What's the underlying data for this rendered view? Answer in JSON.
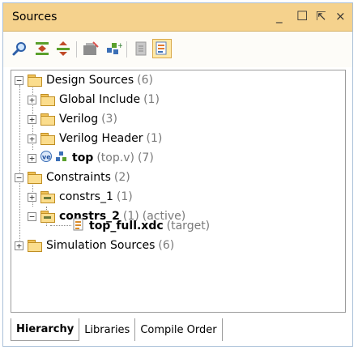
{
  "panel": {
    "title": "Sources",
    "controls": {
      "minimize": "_",
      "maximize": "☐",
      "restore": "⇱",
      "close": "×"
    }
  },
  "toolbar": {
    "buttons": [
      "search",
      "collapse-all",
      "expand-all",
      "add-sources",
      "open-hierarchy",
      "properties",
      "show-hierarchy-active"
    ]
  },
  "tree": {
    "design_sources": {
      "label": "Design Sources",
      "count": "(6)"
    },
    "global_include": {
      "label": "Global Include",
      "count": "(1)"
    },
    "verilog": {
      "label": "Verilog",
      "count": "(3)"
    },
    "verilog_header": {
      "label": "Verilog Header",
      "count": "(1)"
    },
    "top": {
      "label": "top",
      "file": "(top.v)",
      "count": "(7)"
    },
    "constraints": {
      "label": "Constraints",
      "count": "(2)"
    },
    "constrs_1": {
      "label": "constrs_1",
      "count": "(1)"
    },
    "constrs_2": {
      "label": "constrs_2",
      "count": "(1)",
      "status": "(active)"
    },
    "top_full": {
      "label": "top_full.xdc",
      "status": "(target)"
    },
    "simulation_sources": {
      "label": "Simulation Sources",
      "count": "(6)"
    }
  },
  "tabs": {
    "hierarchy": "Hierarchy",
    "libraries": "Libraries",
    "compile_order": "Compile Order",
    "active": "Hierarchy"
  }
}
